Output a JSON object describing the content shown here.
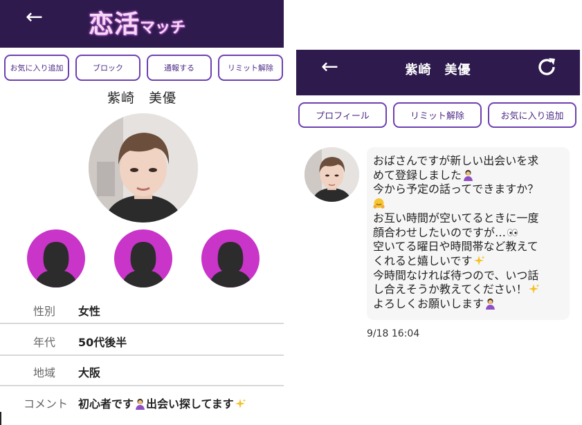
{
  "left": {
    "header": {
      "back_icon": "arrow-left-icon",
      "logo_main": "恋活",
      "logo_sub": "マッチ"
    },
    "buttons": [
      {
        "label": "お気に入り追加"
      },
      {
        "label": "ブロック"
      },
      {
        "label": "通報する"
      },
      {
        "label": "リミット解除"
      }
    ],
    "name": "紫崎　美優",
    "profile": [
      {
        "label": "性別",
        "value": "女性"
      },
      {
        "label": "年代",
        "value": "50代後半"
      },
      {
        "label": "地域",
        "value": "大阪"
      },
      {
        "label": "コメント",
        "value_a": "初心者です",
        "value_b": "出会い探してます"
      }
    ]
  },
  "right": {
    "header": {
      "title": "紫崎　美優",
      "back_icon": "arrow-left-icon",
      "refresh_icon": "refresh-icon"
    },
    "buttons": [
      {
        "label": "プロフィール"
      },
      {
        "label": "リミット解除"
      },
      {
        "label": "お気に入り追加"
      }
    ],
    "message": {
      "lines": [
        "おばさんですが新しい出会いを求",
        "めて登録しました",
        "今から予定の話ってできますか？",
        "",
        "お互い時間が空いてるときに一度",
        "顔合わせしたいのですが…",
        "空いてる曜日や時間帯など教えて",
        "くれると嬉しいです",
        "今時間なければ待つので、いつ話",
        "し合えそうか教えてください！",
        "よろしくお願いします"
      ],
      "time": "9/18 16:04"
    }
  },
  "colors": {
    "header_bg": "#2e1a4d",
    "button_border": "#6d3fb0",
    "thumb_bg": "#c934c9"
  }
}
